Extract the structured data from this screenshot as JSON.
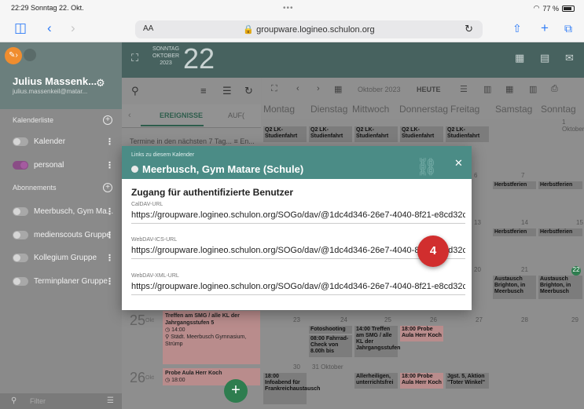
{
  "status_bar": {
    "time_date": "22:29  Sonntag 22. Okt.",
    "battery": "77 %"
  },
  "browser": {
    "aa": "AA",
    "url": "groupware.logineo.schulon.org"
  },
  "sidebar": {
    "user_name": "Julius Massenk...",
    "user_email": "julius.massenkeil@matar...",
    "calendar_list_label": "Kalenderliste",
    "subscriptions_label": "Abonnements",
    "calendars": [
      {
        "label": "Kalender",
        "on": false
      },
      {
        "label": "personal",
        "on": true
      }
    ],
    "subscriptions": [
      {
        "label": "Meerbusch, Gym Ma..."
      },
      {
        "label": "medienscouts Gruppe"
      },
      {
        "label": "Kollegium Gruppe"
      },
      {
        "label": "Terminplaner Gruppe"
      }
    ],
    "filter_placeholder": "Filter"
  },
  "header": {
    "day_label_1": "SONNTAG",
    "day_label_2": "OKTOBER",
    "day_label_3": "2023",
    "day_number": "22"
  },
  "list": {
    "tab_events": "EREIGNISSE",
    "tab_tasks": "AUF(",
    "upcoming_text": "Termine in den nächsten 7 Tag...",
    "upcoming_filter": "En...",
    "agenda": [
      {
        "day": "25",
        "dow": "Okt",
        "title": "Treffen am SMG / alle KL der Jahrgangsstufen 5",
        "time": "14:00",
        "place": "Städt. Meerbusch Gymnasium, Strümp"
      },
      {
        "day": "26",
        "dow": "Okt",
        "title": "Probe Aula Herr Koch",
        "time": "18:00"
      }
    ]
  },
  "calendar": {
    "month_label": "Oktober 2023",
    "today_label": "HEUTE",
    "days": [
      "Montag",
      "Dienstag",
      "Mittwoch",
      "Donnerstag",
      "Freitag",
      "Samstag",
      "Sonntag"
    ],
    "events": {
      "studienfahrt": "Q2 LK-Studienfahrt",
      "herbstferien": "Herbstferien",
      "austausch": "Austausch Brighton, in Meerbusch",
      "fotoshooting": "Fotoshooting",
      "treffen": "14:00 Treffen am SMG / alle KL der Jahrgangsstufen",
      "probe": "18:00 Probe Aula Herr Koch",
      "fahrrad": "08:00 Fahrrad-Check von 8.00h bis",
      "infoabend": "Infoabend für Frankreichaustausch",
      "allerheiligen": "Allerheiligen, unterrichtsfrei",
      "aktion": "Jgst. 5, Aktion \"Toter Winkel\"",
      "time_1800": "18:00",
      "oktober_31": "31 Oktober",
      "oktober_1": "1 Oktober"
    },
    "dates": {
      "d6": "6",
      "d7": "7",
      "d13": "13",
      "d14": "14",
      "d15": "15",
      "d20": "20",
      "d21": "21",
      "d22": "22",
      "d23": "23",
      "d24": "24",
      "d25": "25",
      "d26": "26",
      "d27": "27",
      "d28": "28",
      "d29": "29",
      "d30": "30"
    }
  },
  "modal": {
    "subtitle": "Links zu diesem Kalender",
    "title": "Meerbusch, Gym Matare (Schule)",
    "heading": "Zugang für authentifizierte Benutzer",
    "fields": [
      {
        "label": "CalDAV-URL",
        "url": "https://groupware.logineo.schulon.org/SOGo/dav/@1dc4d346-26e7-4040-8f21-e8cd32c3647c/Calendar/"
      },
      {
        "label": "WebDAV-ICS-URL",
        "url": "https://groupware.logineo.schulon.org/SOGo/dav/@1dc4d346-26e7-4040-8f21-e8cd32c3647c/Calendar/"
      },
      {
        "label": "WebDAV-XML-URL",
        "url": "https://groupware.logineo.schulon.org/SOGo/dav/@1dc4d346-26e7-4040-8f21-e8cd32c3647c/Calendar/"
      }
    ]
  },
  "step_badge": "4",
  "colors": {
    "header": "#47625f",
    "modal_header": "#4b8c86",
    "accent_purple": "#8a4d86",
    "badge_red": "#d12e2e",
    "fab_green": "#2e7d4f"
  }
}
